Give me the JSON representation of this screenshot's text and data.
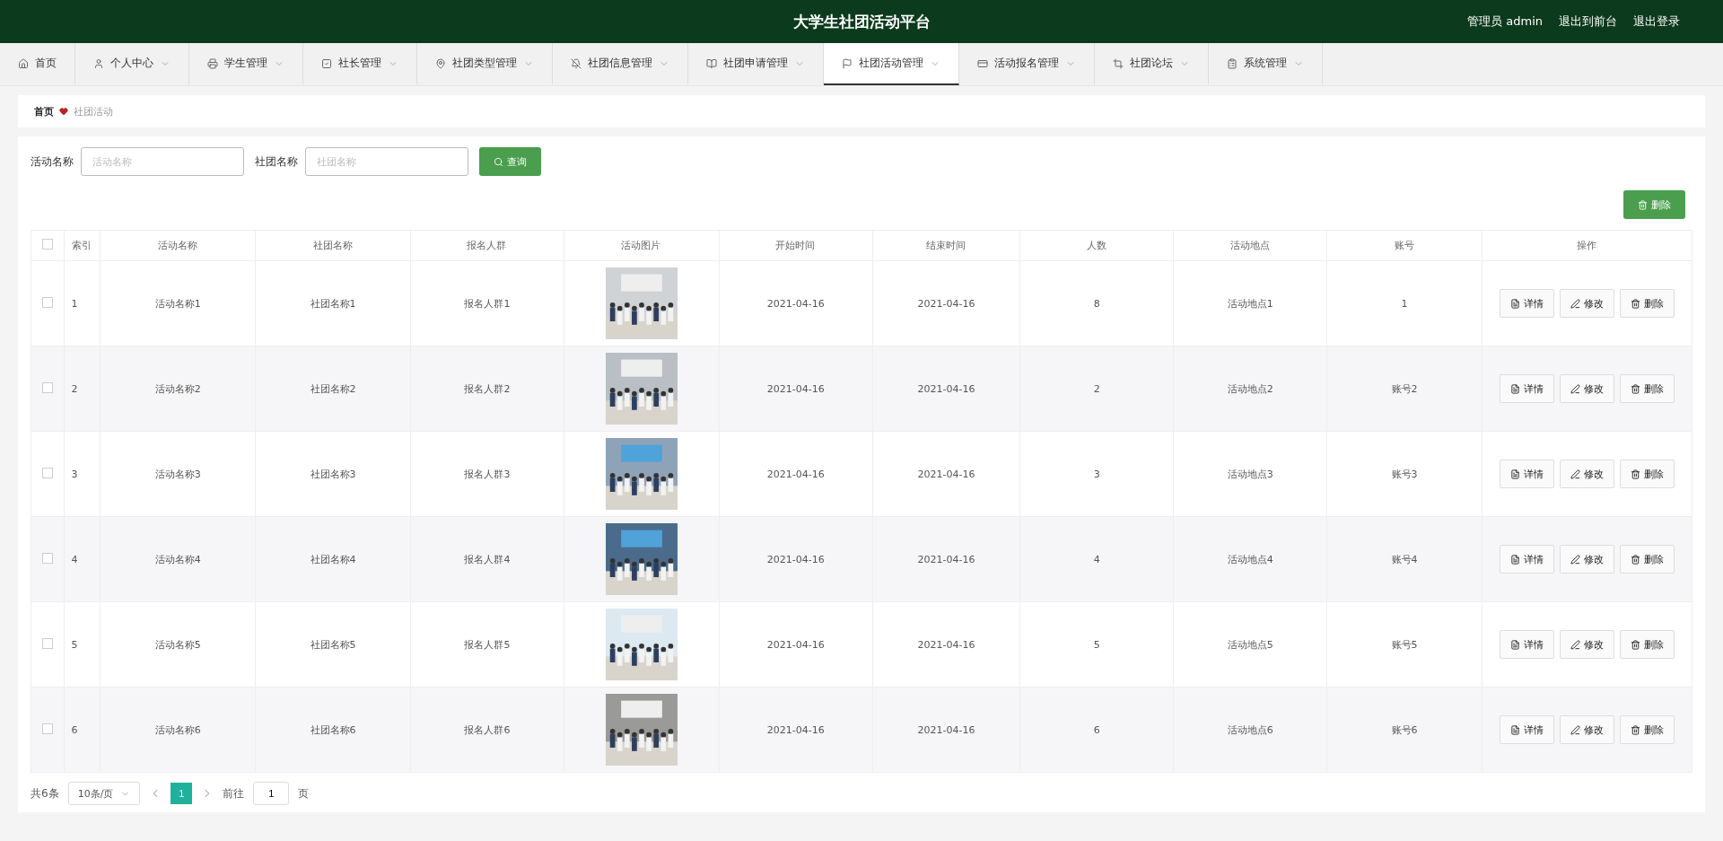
{
  "header": {
    "title": "大学生社团活动平台",
    "links": [
      "管理员 admin",
      "退出到前台",
      "退出登录"
    ]
  },
  "nav": [
    {
      "label": "首页",
      "kind": "link",
      "selected": false
    },
    {
      "label": "个人中心",
      "kind": "menu",
      "selected": false
    },
    {
      "label": "学生管理",
      "kind": "menu",
      "selected": false
    },
    {
      "label": "社长管理",
      "kind": "menu",
      "selected": false
    },
    {
      "label": "社团类型管理",
      "kind": "menu",
      "selected": false
    },
    {
      "label": "社团信息管理",
      "kind": "menu",
      "selected": false
    },
    {
      "label": "社团申请管理",
      "kind": "menu",
      "selected": false
    },
    {
      "label": "社团活动管理",
      "kind": "menu",
      "selected": true
    },
    {
      "label": "活动报名管理",
      "kind": "menu",
      "selected": false
    },
    {
      "label": "社团论坛",
      "kind": "menu",
      "selected": false
    },
    {
      "label": "系统管理",
      "kind": "menu",
      "selected": false
    }
  ],
  "breadcrumb": [
    "首页",
    "社团活动"
  ],
  "search": {
    "fields": [
      {
        "label": "活动名称",
        "placeholder": "活动名称"
      },
      {
        "label": "社团名称",
        "placeholder": "社团名称"
      }
    ],
    "button": "查询"
  },
  "delete_button": "删除",
  "table": {
    "select_all": {
      "checked": false
    },
    "columns": [
      "索引",
      "活动名称",
      "社团名称",
      "报名人群",
      "活动图片",
      "开始时间",
      "结束时间",
      "人数",
      "活动地点",
      "账号",
      "操作"
    ],
    "rows": [
      {
        "checked": false,
        "cells": [
          {
            "kind": "text",
            "text": "1"
          },
          {
            "kind": "text",
            "text": "活动名称1"
          },
          {
            "kind": "text",
            "text": "社团名称1"
          },
          {
            "kind": "text",
            "text": "报名人群1"
          },
          {
            "kind": "picture"
          },
          {
            "kind": "text",
            "text": "2021-04-16"
          },
          {
            "kind": "text",
            "text": "2021-04-16"
          },
          {
            "kind": "text",
            "text": "8"
          },
          {
            "kind": "text",
            "text": "活动地点1"
          },
          {
            "kind": "text",
            "text": "1"
          },
          {
            "kind": "actions",
            "buttons": [
              {
                "kind": "detail",
                "label": "详情"
              },
              {
                "kind": "edit",
                "label": "修改"
              },
              {
                "kind": "delete",
                "label": "删除"
              }
            ]
          }
        ]
      },
      {
        "checked": false,
        "cells": [
          {
            "kind": "text",
            "text": "2"
          },
          {
            "kind": "text",
            "text": "活动名称2"
          },
          {
            "kind": "text",
            "text": "社团名称2"
          },
          {
            "kind": "text",
            "text": "报名人群2"
          },
          {
            "kind": "picture"
          },
          {
            "kind": "text",
            "text": "2021-04-16"
          },
          {
            "kind": "text",
            "text": "2021-04-16"
          },
          {
            "kind": "text",
            "text": "2"
          },
          {
            "kind": "text",
            "text": "活动地点2"
          },
          {
            "kind": "text",
            "text": "账号2"
          },
          {
            "kind": "actions",
            "buttons": [
              {
                "kind": "detail",
                "label": "详情"
              },
              {
                "kind": "edit",
                "label": "修改"
              },
              {
                "kind": "delete",
                "label": "删除"
              }
            ]
          }
        ]
      },
      {
        "checked": false,
        "cells": [
          {
            "kind": "text",
            "text": "3"
          },
          {
            "kind": "text",
            "text": "活动名称3"
          },
          {
            "kind": "text",
            "text": "社团名称3"
          },
          {
            "kind": "text",
            "text": "报名人群3"
          },
          {
            "kind": "picture"
          },
          {
            "kind": "text",
            "text": "2021-04-16"
          },
          {
            "kind": "text",
            "text": "2021-04-16"
          },
          {
            "kind": "text",
            "text": "3"
          },
          {
            "kind": "text",
            "text": "活动地点3"
          },
          {
            "kind": "text",
            "text": "账号3"
          },
          {
            "kind": "actions",
            "buttons": [
              {
                "kind": "detail",
                "label": "详情"
              },
              {
                "kind": "edit",
                "label": "修改"
              },
              {
                "kind": "delete",
                "label": "删除"
              }
            ]
          }
        ]
      },
      {
        "checked": false,
        "cells": [
          {
            "kind": "text",
            "text": "4"
          },
          {
            "kind": "text",
            "text": "活动名称4"
          },
          {
            "kind": "text",
            "text": "社团名称4"
          },
          {
            "kind": "text",
            "text": "报名人群4"
          },
          {
            "kind": "picture"
          },
          {
            "kind": "text",
            "text": "2021-04-16"
          },
          {
            "kind": "text",
            "text": "2021-04-16"
          },
          {
            "kind": "text",
            "text": "4"
          },
          {
            "kind": "text",
            "text": "活动地点4"
          },
          {
            "kind": "text",
            "text": "账号4"
          },
          {
            "kind": "actions",
            "buttons": [
              {
                "kind": "detail",
                "label": "详情"
              },
              {
                "kind": "edit",
                "label": "修改"
              },
              {
                "kind": "delete",
                "label": "删除"
              }
            ]
          }
        ]
      },
      {
        "checked": false,
        "cells": [
          {
            "kind": "text",
            "text": "5"
          },
          {
            "kind": "text",
            "text": "活动名称5"
          },
          {
            "kind": "text",
            "text": "社团名称5"
          },
          {
            "kind": "text",
            "text": "报名人群5"
          },
          {
            "kind": "picture"
          },
          {
            "kind": "text",
            "text": "2021-04-16"
          },
          {
            "kind": "text",
            "text": "2021-04-16"
          },
          {
            "kind": "text",
            "text": "5"
          },
          {
            "kind": "text",
            "text": "活动地点5"
          },
          {
            "kind": "text",
            "text": "账号5"
          },
          {
            "kind": "actions",
            "buttons": [
              {
                "kind": "detail",
                "label": "详情"
              },
              {
                "kind": "edit",
                "label": "修改"
              },
              {
                "kind": "delete",
                "label": "删除"
              }
            ]
          }
        ]
      },
      {
        "checked": false,
        "cells": [
          {
            "kind": "text",
            "text": "6"
          },
          {
            "kind": "text",
            "text": "活动名称6"
          },
          {
            "kind": "text",
            "text": "社团名称6"
          },
          {
            "kind": "text",
            "text": "报名人群6"
          },
          {
            "kind": "picture"
          },
          {
            "kind": "text",
            "text": "2021-04-16"
          },
          {
            "kind": "text",
            "text": "2021-04-16"
          },
          {
            "kind": "text",
            "text": "6"
          },
          {
            "kind": "text",
            "text": "活动地点6"
          },
          {
            "kind": "text",
            "text": "账号6"
          },
          {
            "kind": "actions",
            "buttons": [
              {
                "kind": "detail",
                "label": "详情"
              },
              {
                "kind": "edit",
                "label": "修改"
              },
              {
                "kind": "delete",
                "label": "删除"
              }
            ]
          }
        ]
      }
    ]
  },
  "pagination": {
    "total": "共6条",
    "page_size": "10条/页",
    "pages": [
      {
        "label": "1",
        "selected": true
      }
    ],
    "goto_label": "前往",
    "goto_value": "1",
    "goto_suffix": "页"
  }
}
